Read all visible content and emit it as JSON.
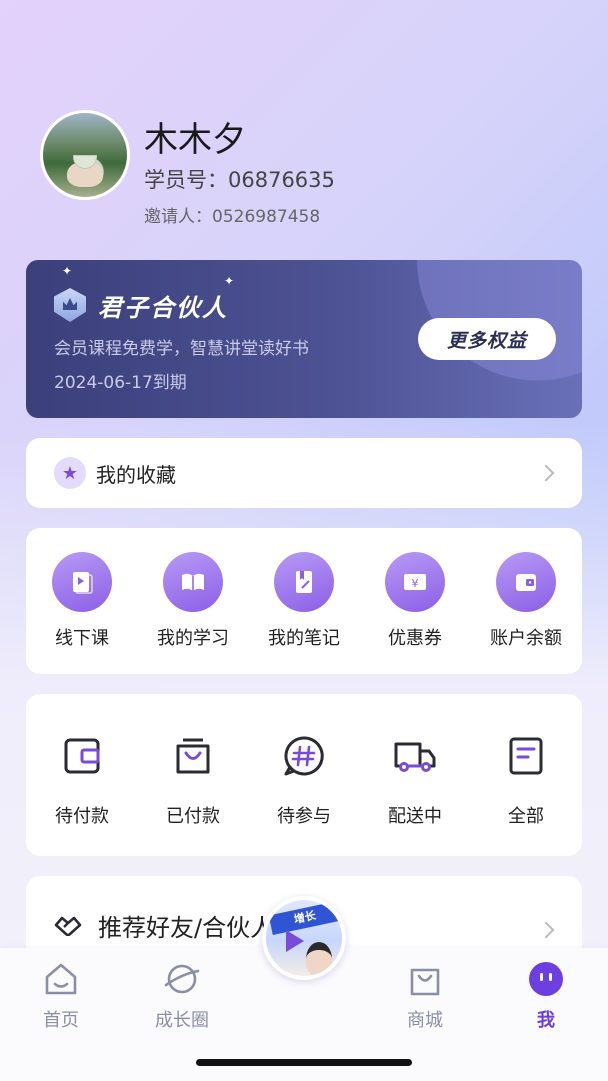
{
  "profile": {
    "name": "木木夕",
    "student_no": "学员号：06876635",
    "inviter": "邀请人：0526987458"
  },
  "vip": {
    "title": "君子合伙人",
    "desc": "会员课程免费学，智慧讲堂读好书",
    "expire": "2024-06-17到期",
    "button": "更多权益"
  },
  "favorites": {
    "label": "我的收藏",
    "icon": "star-icon"
  },
  "tools": [
    {
      "label": "线下课",
      "icon": "video-lesson-icon"
    },
    {
      "label": "我的学习",
      "icon": "open-book-icon"
    },
    {
      "label": "我的笔记",
      "icon": "notebook-pen-icon"
    },
    {
      "label": "优惠券",
      "icon": "coupon-icon"
    },
    {
      "label": "账户余额",
      "icon": "wallet-icon"
    }
  ],
  "orders": [
    {
      "label": "待付款",
      "icon": "wallet-outline-icon"
    },
    {
      "label": "已付款",
      "icon": "shopping-bag-icon"
    },
    {
      "label": "待参与",
      "icon": "hashtag-bubble-icon"
    },
    {
      "label": "配送中",
      "icon": "delivery-truck-icon"
    },
    {
      "label": "全部",
      "icon": "document-list-icon"
    }
  ],
  "recommend": {
    "label": "推荐好友/合伙人",
    "icon": "handshake-icon"
  },
  "tabbar": {
    "items": [
      {
        "label": "首页",
        "icon": "home-icon",
        "active": false
      },
      {
        "label": "成长圈",
        "icon": "planet-icon",
        "active": false
      },
      {
        "label": "商城",
        "icon": "bag-icon",
        "active": false
      },
      {
        "label": "我",
        "icon": "profile-face-icon",
        "active": true
      }
    ],
    "center_banner": "增长"
  },
  "colors": {
    "accent": "#7a4bd8",
    "vip_bg": "#3b3f7a",
    "active_tab": "#6b3fe0"
  }
}
